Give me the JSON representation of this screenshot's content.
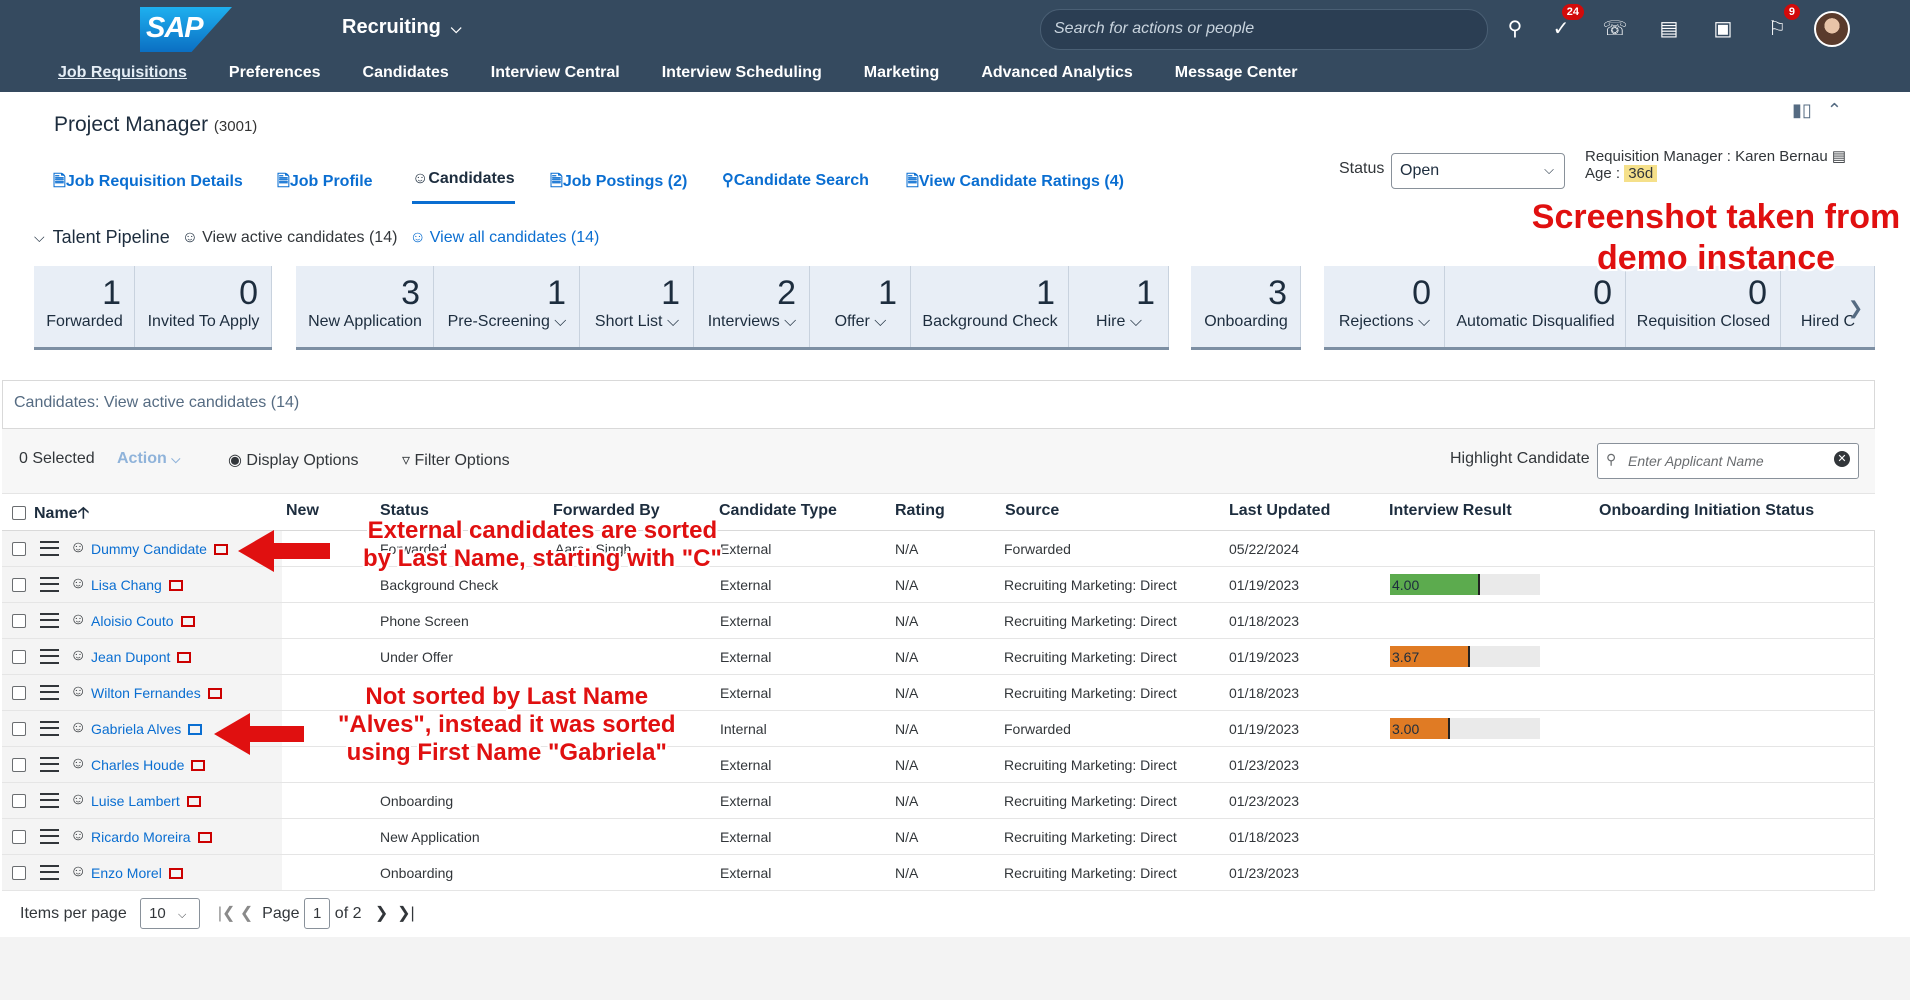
{
  "shell": {
    "logo": "SAP",
    "app_menu": "Recruiting",
    "search_placeholder": "Search for actions or people",
    "todo_badge": "24",
    "notif_badge": "9"
  },
  "nav": [
    "Job Requisitions",
    "Preferences",
    "Candidates",
    "Interview Central",
    "Interview Scheduling",
    "Marketing",
    "Advanced Analytics",
    "Message Center"
  ],
  "header": {
    "title": "Project Manager",
    "req_id": "(3001)",
    "tabs": [
      "Job Requisition Details",
      "Job Profile",
      "Candidates",
      "Job Postings (2)",
      "Candidate Search",
      "View Candidate Ratings (4)"
    ],
    "status_label": "Status",
    "status_value": "Open",
    "req_manager_label": "Requisition Manager",
    "req_manager_value": "Karen Bernau",
    "age_label": "Age :",
    "age_value": "36d"
  },
  "pipeline": {
    "title": "Talent Pipeline",
    "active_link": "View active candidates (14)",
    "all_link": "View all candidates (14)",
    "stages": [
      {
        "count": "1",
        "label": "Forwarded"
      },
      {
        "count": "0",
        "label": "Invited To Apply"
      },
      {
        "count": "3",
        "label": "New Application"
      },
      {
        "count": "1",
        "label": "Pre-Screening ⌵"
      },
      {
        "count": "1",
        "label": "Short List ⌵"
      },
      {
        "count": "2",
        "label": "Interviews ⌵"
      },
      {
        "count": "1",
        "label": "Offer ⌵"
      },
      {
        "count": "1",
        "label": "Background Check"
      },
      {
        "count": "1",
        "label": "Hire ⌵"
      },
      {
        "count": "3",
        "label": "Onboarding"
      },
      {
        "count": "0",
        "label": "Rejections ⌵"
      },
      {
        "count": "0",
        "label": "Automatic Disqualified"
      },
      {
        "count": "0",
        "label": "Requisition Closed"
      },
      {
        "count": "",
        "label": "Hired C"
      }
    ]
  },
  "demo_note": "Screenshot taken from demo instance",
  "table": {
    "panel_title": "Candidates: View active candidates (14)",
    "selected": "0 Selected",
    "action": "Action",
    "display_options": "Display Options",
    "filter_options": "Filter Options",
    "highlight_label": "Highlight Candidate",
    "highlight_placeholder": "Enter Applicant Name",
    "columns": [
      "Name",
      "New",
      "Status",
      "Forwarded By",
      "Candidate Type",
      "Rating",
      "Source",
      "Last Updated",
      "Interview Result",
      "Onboarding Initiation Status"
    ],
    "rows": [
      {
        "name": "Dummy Candidate",
        "type_flag": "ext",
        "status": "Forwarded",
        "forwarded_by": "Aarav Singh",
        "ctype": "External",
        "rating": "N/A",
        "source": "Forwarded",
        "updated": "05/22/2024",
        "result": null
      },
      {
        "name": "Lisa Chang",
        "type_flag": "ext",
        "status": "Background Check",
        "forwarded_by": "",
        "ctype": "External",
        "rating": "N/A",
        "source": "Recruiting Marketing: Direct",
        "updated": "01/19/2023",
        "result": "4.00"
      },
      {
        "name": "Aloisio Couto",
        "type_flag": "ext",
        "status": "Phone Screen",
        "forwarded_by": "",
        "ctype": "External",
        "rating": "N/A",
        "source": "Recruiting Marketing: Direct",
        "updated": "01/18/2023",
        "result": null
      },
      {
        "name": "Jean Dupont",
        "type_flag": "ext",
        "status": "Under Offer",
        "forwarded_by": "",
        "ctype": "External",
        "rating": "N/A",
        "source": "Recruiting Marketing: Direct",
        "updated": "01/19/2023",
        "result": "3.67"
      },
      {
        "name": "Wilton Fernandes",
        "type_flag": "ext",
        "status": "",
        "forwarded_by": "",
        "ctype": "External",
        "rating": "N/A",
        "source": "Recruiting Marketing: Direct",
        "updated": "01/18/2023",
        "result": null
      },
      {
        "name": "Gabriela Alves",
        "type_flag": "int",
        "status": "",
        "forwarded_by": "",
        "ctype": "Internal",
        "rating": "N/A",
        "source": "Forwarded",
        "updated": "01/19/2023",
        "result": "3.00"
      },
      {
        "name": "Charles Houde",
        "type_flag": "ext",
        "status": "",
        "forwarded_by": "",
        "ctype": "External",
        "rating": "N/A",
        "source": "Recruiting Marketing: Direct",
        "updated": "01/23/2023",
        "result": null
      },
      {
        "name": "Luise Lambert",
        "type_flag": "ext",
        "status": "Onboarding",
        "forwarded_by": "",
        "ctype": "External",
        "rating": "N/A",
        "source": "Recruiting Marketing: Direct",
        "updated": "01/23/2023",
        "result": null
      },
      {
        "name": "Ricardo Moreira",
        "type_flag": "ext",
        "status": "New Application",
        "forwarded_by": "",
        "ctype": "External",
        "rating": "N/A",
        "source": "Recruiting Marketing: Direct",
        "updated": "01/18/2023",
        "result": null
      },
      {
        "name": "Enzo Morel",
        "type_flag": "ext",
        "status": "Onboarding",
        "forwarded_by": "",
        "ctype": "External",
        "rating": "N/A",
        "source": "Recruiting Marketing: Direct",
        "updated": "01/23/2023",
        "result": null
      }
    ],
    "result_colors": {
      "4.00": "#5cab4e",
      "3.67": "#e07b24",
      "3.00": "#e07b24"
    },
    "result_fractions": {
      "4.00": 0.6,
      "3.67": 0.53,
      "3.00": 0.4
    }
  },
  "footer": {
    "items_label": "Items per page",
    "items_value": "10",
    "page_label": "Page",
    "page_value": "1",
    "of_label": "of 2"
  },
  "annotations": {
    "a1": [
      "External candidates are sorted",
      "by Last Name, starting with \"C\""
    ],
    "a2": [
      "Not sorted by Last Name",
      "\"Alves\", instead it was sorted",
      "using First Name \"Gabriela\""
    ]
  }
}
